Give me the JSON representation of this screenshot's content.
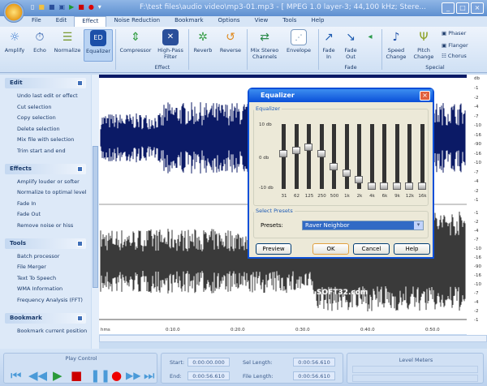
{
  "titlebar": {
    "title": "F:\\test files\\audio video\\mp3-01.mp3 - [ MPEG 1.0 layer-3; 44,100 kHz; Stere..."
  },
  "menu": [
    "File",
    "Edit",
    "Effect",
    "Noise Reduction",
    "Bookmark",
    "Options",
    "View",
    "Tools",
    "Help"
  ],
  "ribbon": {
    "buttons": [
      "Amplify",
      "Echo",
      "Normalize",
      "Equalizer",
      "Compressor",
      "High-Pass Filter",
      "Reverb",
      "Reverse",
      "Mix Stereo Channels",
      "Envelope",
      "Fade In",
      "Fade Out",
      "Speed Change",
      "Pitch Change"
    ],
    "small": [
      "Phaser",
      "Flanger",
      "Chorus"
    ],
    "groups": [
      "Effect",
      "Fade",
      "Special"
    ]
  },
  "sidebar": [
    {
      "title": "Edit",
      "items": [
        "Undo last edit or effect",
        "Cut selection",
        "Copy selection",
        "Delete selection",
        "Mix file with selection",
        "Trim start and end"
      ]
    },
    {
      "title": "Effects",
      "items": [
        "Amplify louder or softer",
        "Normalize to optimal level",
        "Fade In",
        "Fade Out",
        "Remove noise or hiss"
      ]
    },
    {
      "title": "Tools",
      "items": [
        "Batch processor",
        "File Merger",
        "Text To Speech",
        "WMA Information",
        "Frequency Analysis (FFT)"
      ]
    },
    {
      "title": "Bookmark",
      "items": [
        "Bookmark current position"
      ]
    }
  ],
  "ruler": {
    "unit": "db",
    "labels": [
      "-1",
      "-2",
      "-4",
      "-7",
      "-10",
      "-16",
      "-90",
      "-16",
      "-10",
      "-7",
      "-4",
      "-2",
      "-1"
    ]
  },
  "timeline": [
    "hms",
    "0:10.0",
    "0:20.0",
    "0:30.0",
    "0:40.0",
    "0:50.0"
  ],
  "watermark": "SOFT32.com",
  "equalizer": {
    "title": "Equalizer",
    "group": "Equalizer",
    "db_labels": [
      "10 db",
      "0 db",
      "-10 db"
    ],
    "bands": [
      {
        "f": "31",
        "db": 1
      },
      {
        "f": "62",
        "db": 2
      },
      {
        "f": "125",
        "db": 3
      },
      {
        "f": "250",
        "db": 1
      },
      {
        "f": "500",
        "db": -3
      },
      {
        "f": "1k",
        "db": -5
      },
      {
        "f": "2k",
        "db": -7
      },
      {
        "f": "4k",
        "db": -9
      },
      {
        "f": "6k",
        "db": -9
      },
      {
        "f": "9k",
        "db": -9
      },
      {
        "f": "12k",
        "db": -9
      },
      {
        "f": "16k",
        "db": -9
      }
    ],
    "presets_group": "Select Presets",
    "presets_label": "Presets:",
    "preset_value": "Raver Neighbor",
    "buttons": {
      "preview": "Preview",
      "ok": "OK",
      "cancel": "Cancel",
      "help": "Help"
    }
  },
  "play_control": {
    "title": "Play Control"
  },
  "times": {
    "start_label": "Start:",
    "start": "0:00:00.000",
    "end_label": "End:",
    "end": "0:00:56.610",
    "sel_label": "Sel Length:",
    "sel": "0:00:56.610",
    "file_label": "File Length:",
    "file": "0:00:56.610"
  },
  "level_meters": {
    "title": "Level Meters"
  },
  "colors": {
    "wave_top": "#0b1a66",
    "wave_bottom": "#3a3a3a",
    "accent": "#0a4fd8"
  }
}
